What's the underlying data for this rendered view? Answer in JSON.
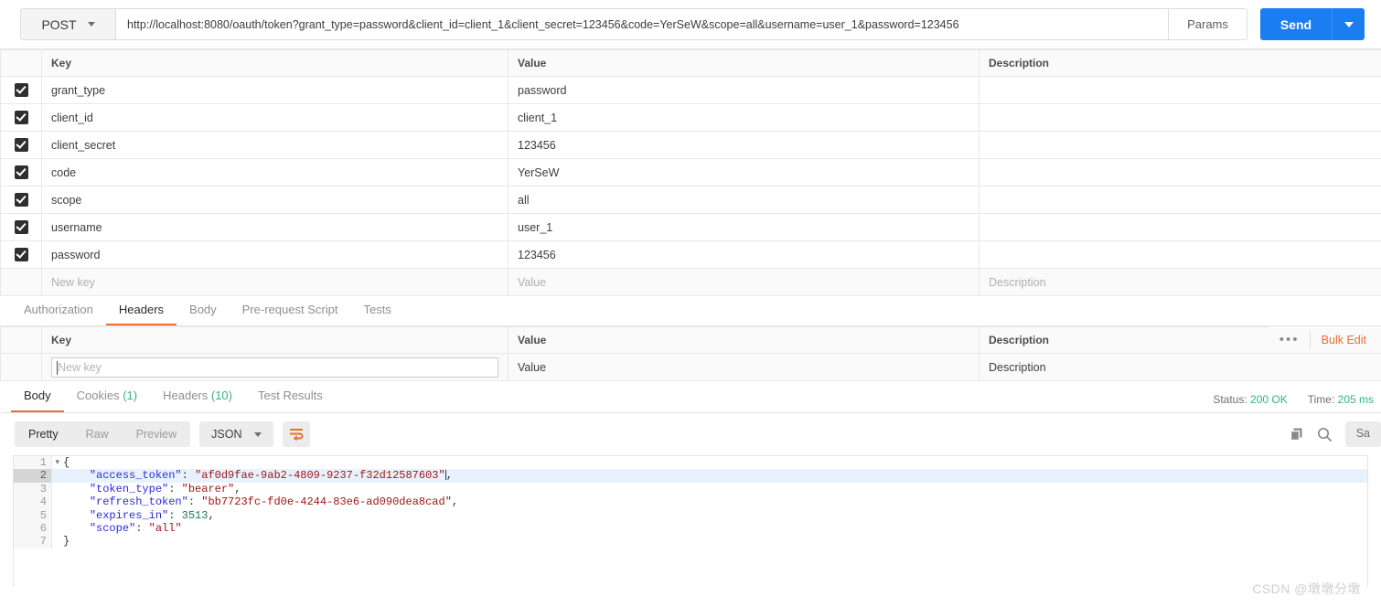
{
  "request": {
    "method": "POST",
    "url": "http://localhost:8080/oauth/token?grant_type=password&client_id=client_1&client_secret=123456&code=YerSeW&scope=all&username=user_1&password=123456",
    "params_button": "Params",
    "send_button": "Send"
  },
  "params_table": {
    "columns": [
      "Key",
      "Value",
      "Description"
    ],
    "rows": [
      {
        "checked": true,
        "key": "grant_type",
        "value": "password",
        "description": ""
      },
      {
        "checked": true,
        "key": "client_id",
        "value": "client_1",
        "description": ""
      },
      {
        "checked": true,
        "key": "client_secret",
        "value": "123456",
        "description": ""
      },
      {
        "checked": true,
        "key": "code",
        "value": "YerSeW",
        "description": ""
      },
      {
        "checked": true,
        "key": "scope",
        "value": "all",
        "description": ""
      },
      {
        "checked": true,
        "key": "username",
        "value": "user_1",
        "description": ""
      },
      {
        "checked": true,
        "key": "password",
        "value": "123456",
        "description": ""
      }
    ],
    "new_row": {
      "key_placeholder": "New key",
      "value_placeholder": "Value",
      "description_placeholder": "Description"
    }
  },
  "request_tabs": [
    {
      "label": "Authorization",
      "active": false
    },
    {
      "label": "Headers",
      "active": true
    },
    {
      "label": "Body",
      "active": false
    },
    {
      "label": "Pre-request Script",
      "active": false
    },
    {
      "label": "Tests",
      "active": false
    }
  ],
  "headers_table": {
    "columns": [
      "Key",
      "Value",
      "Description"
    ],
    "bulk_edit_label": "Bulk Edit",
    "more_label": "•••",
    "new_row": {
      "key_placeholder": "New key",
      "value_placeholder": "Value",
      "description_placeholder": "Description"
    }
  },
  "response_tabs": [
    {
      "label": "Body",
      "count": "",
      "active": true
    },
    {
      "label": "Cookies",
      "count": "(1)",
      "active": false
    },
    {
      "label": "Headers",
      "count": "(10)",
      "active": false
    },
    {
      "label": "Test Results",
      "count": "",
      "active": false
    }
  ],
  "response_meta": {
    "status_label": "Status:",
    "status_value": "200 OK",
    "time_label": "Time:",
    "time_value": "205 ms"
  },
  "view_toolbar": {
    "modes": [
      {
        "label": "Pretty",
        "active": true
      },
      {
        "label": "Raw",
        "active": false
      },
      {
        "label": "Preview",
        "active": false
      }
    ],
    "format": "JSON",
    "save_response_label": "Sa"
  },
  "response_body": {
    "language": "json",
    "active_line": 2,
    "lines": [
      {
        "n": "1",
        "fold": true,
        "indent": 0,
        "tokens": [
          {
            "t": "punc",
            "s": "{"
          }
        ]
      },
      {
        "n": "2",
        "fold": false,
        "indent": 4,
        "tokens": [
          {
            "t": "key",
            "s": "\"access_token\""
          },
          {
            "t": "punc",
            "s": ": "
          },
          {
            "t": "str",
            "s": "\"af0d9fae-9ab2-4809-9237-f32d12587603\""
          },
          {
            "t": "punc",
            "s": ","
          }
        ]
      },
      {
        "n": "3",
        "fold": false,
        "indent": 4,
        "tokens": [
          {
            "t": "key",
            "s": "\"token_type\""
          },
          {
            "t": "punc",
            "s": ": "
          },
          {
            "t": "str",
            "s": "\"bearer\""
          },
          {
            "t": "punc",
            "s": ","
          }
        ]
      },
      {
        "n": "4",
        "fold": false,
        "indent": 4,
        "tokens": [
          {
            "t": "key",
            "s": "\"refresh_token\""
          },
          {
            "t": "punc",
            "s": ": "
          },
          {
            "t": "str",
            "s": "\"bb7723fc-fd0e-4244-83e6-ad090dea8cad\""
          },
          {
            "t": "punc",
            "s": ","
          }
        ]
      },
      {
        "n": "5",
        "fold": false,
        "indent": 4,
        "tokens": [
          {
            "t": "key",
            "s": "\"expires_in\""
          },
          {
            "t": "punc",
            "s": ": "
          },
          {
            "t": "num",
            "s": "3513"
          },
          {
            "t": "punc",
            "s": ","
          }
        ]
      },
      {
        "n": "6",
        "fold": false,
        "indent": 4,
        "tokens": [
          {
            "t": "key",
            "s": "\"scope\""
          },
          {
            "t": "punc",
            "s": ": "
          },
          {
            "t": "str",
            "s": "\"all\""
          }
        ]
      },
      {
        "n": "7",
        "fold": false,
        "indent": 0,
        "tokens": [
          {
            "t": "punc",
            "s": "}"
          }
        ]
      }
    ],
    "parsed": {
      "access_token": "af0d9fae-9ab2-4809-9237-f32d12587603",
      "token_type": "bearer",
      "refresh_token": "bb7723fc-fd0e-4244-83e6-ad090dea8cad",
      "expires_in": 3513,
      "scope": "all"
    }
  },
  "watermark": "CSDN @墩墩分墩",
  "colors": {
    "accent_orange": "#ef6c35",
    "send_blue": "#1a7ef2",
    "status_green": "#2fb67c"
  }
}
